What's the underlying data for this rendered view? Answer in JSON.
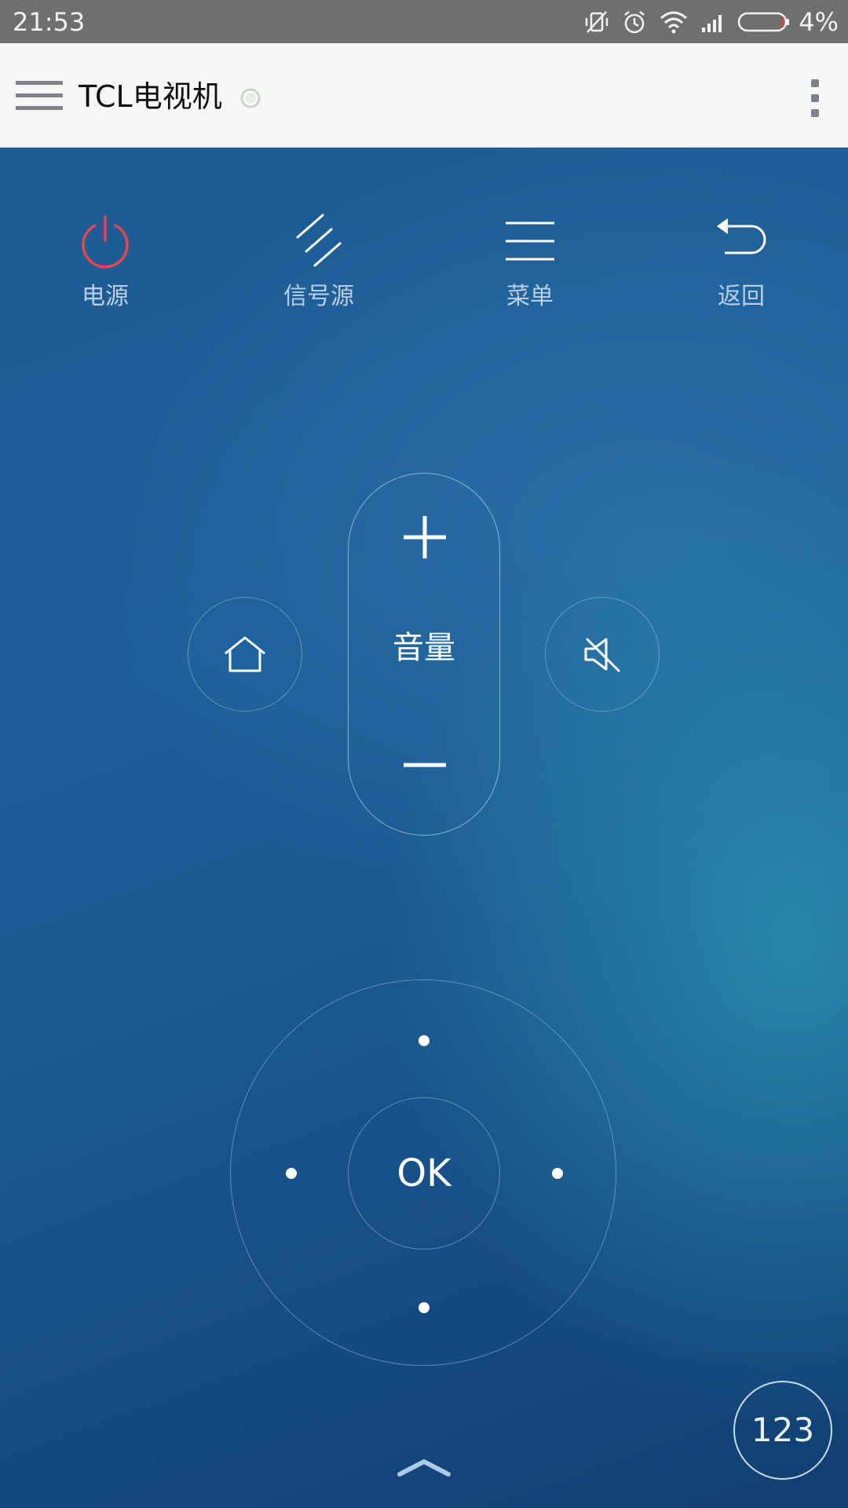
{
  "status_bar": {
    "time": "21:53",
    "icons": [
      "vibrate-off-icon",
      "alarm-icon",
      "wifi-icon",
      "signal-icon",
      "battery-icon"
    ],
    "battery_percent": "4%",
    "battery_level": 0.04,
    "battery_color": "#e53935"
  },
  "app_bar": {
    "title": "TCL电视机",
    "menu_icon": "hamburger-menu-icon",
    "overflow_icon": "more-vert-icon"
  },
  "remote": {
    "top_buttons": [
      {
        "label": "电源",
        "icon": "power-icon",
        "color": "#e5474b"
      },
      {
        "label": "信号源",
        "icon": "signal-source-icon"
      },
      {
        "label": "菜单",
        "icon": "menu-lines-icon"
      },
      {
        "label": "返回",
        "icon": "back-icon"
      }
    ],
    "home_icon": "home-icon",
    "mute_icon": "mute-icon",
    "volume": {
      "label": "音量",
      "up_icon": "plus-icon",
      "down_icon": "minus-icon"
    },
    "dpad": {
      "ok_label": "OK"
    },
    "expand_icon": "chevron-up-icon",
    "numpad_label": "123"
  },
  "colors": {
    "status_bar": "#6f6f6f",
    "app_bar": "#f7f7f7",
    "background_dark": "#103f72",
    "background_light": "#2c94b2",
    "power_red": "#e5474b",
    "label_blue": "#b9cde3"
  }
}
